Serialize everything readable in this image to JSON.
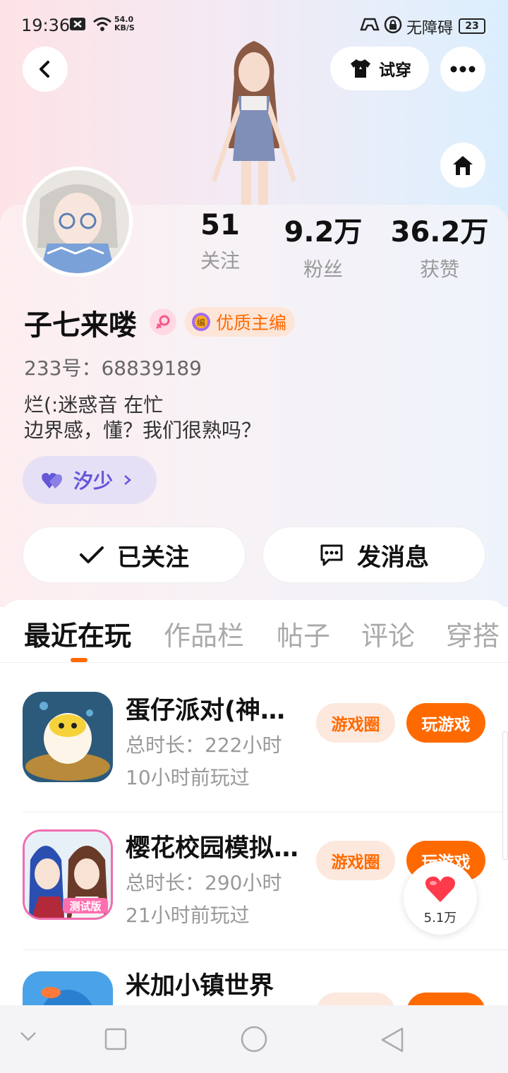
{
  "status": {
    "time": "19:36",
    "speed_top": "54.0",
    "speed_bottom": "KB/S",
    "accessibility": "无障碍",
    "battery": "23"
  },
  "header": {
    "try_on_label": "试穿"
  },
  "stats": [
    {
      "num": "51",
      "label": "关注"
    },
    {
      "num": "9.2万",
      "label": "粉丝"
    },
    {
      "num": "36.2万",
      "label": "获赞"
    }
  ],
  "profile": {
    "name": "子七来喽",
    "badge": "优质主编",
    "badge_icon_char": "编",
    "uid": "233号：68839189",
    "bio_line1": "烂(:迷惑音  在忙",
    "bio_line2": "边界感，懂？我们很熟吗？",
    "cp_name": "汐少"
  },
  "actions": {
    "follow_label": "已关注",
    "message_label": "发消息"
  },
  "tabs": [
    "最近在玩",
    "作品栏",
    "帖子",
    "评论",
    "穿搭"
  ],
  "games": [
    {
      "title": "蛋仔派对(神…",
      "duration": "总时长：222小时",
      "last_played": "10小时前玩过",
      "circle_label": "游戏圈",
      "play_label": "玩游戏"
    },
    {
      "title": "樱花校园模拟…",
      "duration": "总时长：290小时",
      "last_played": "21小时前玩过",
      "circle_label": "游戏圈",
      "play_label": "玩游戏",
      "icon_tag": "测试版"
    },
    {
      "title": "米加小镇世界"
    }
  ],
  "like": {
    "count": "5.1万"
  },
  "colors": {
    "accent": "#ff6a00",
    "cp_purple": "#6457d8"
  }
}
